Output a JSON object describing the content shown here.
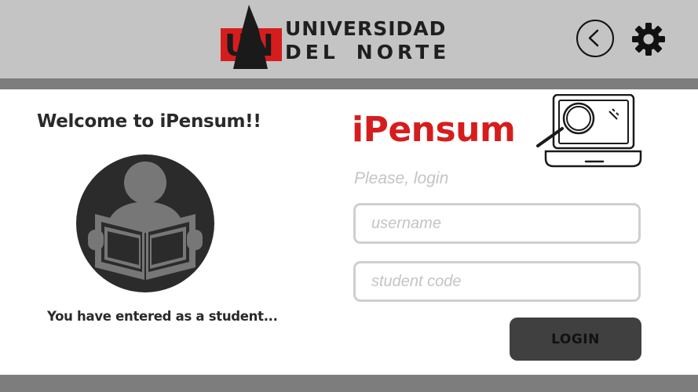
{
  "header": {
    "logo_mark": "UN",
    "logo_line1": "UNIVERSIDAD",
    "logo_line2_a": "DEL",
    "logo_line2_b": "NORTE",
    "back_icon": "chevron-left-icon",
    "settings_icon": "gear-icon"
  },
  "left": {
    "welcome": "Welcome to iPensum!!",
    "avatar_icon": "student-reading-icon",
    "status": "You have entered as a student..."
  },
  "login": {
    "brand": "iPensum",
    "brand_icon": "laptop-search-icon",
    "prompt": "Please, login",
    "username_placeholder": "username",
    "code_placeholder": "student code",
    "button_label": "LOGIN"
  },
  "colors": {
    "header_bg": "#c4c4c4",
    "band": "#7d7d7d",
    "brand_red": "#d61d1d",
    "button_bg": "#404040",
    "input_border": "#cfcfcf"
  }
}
